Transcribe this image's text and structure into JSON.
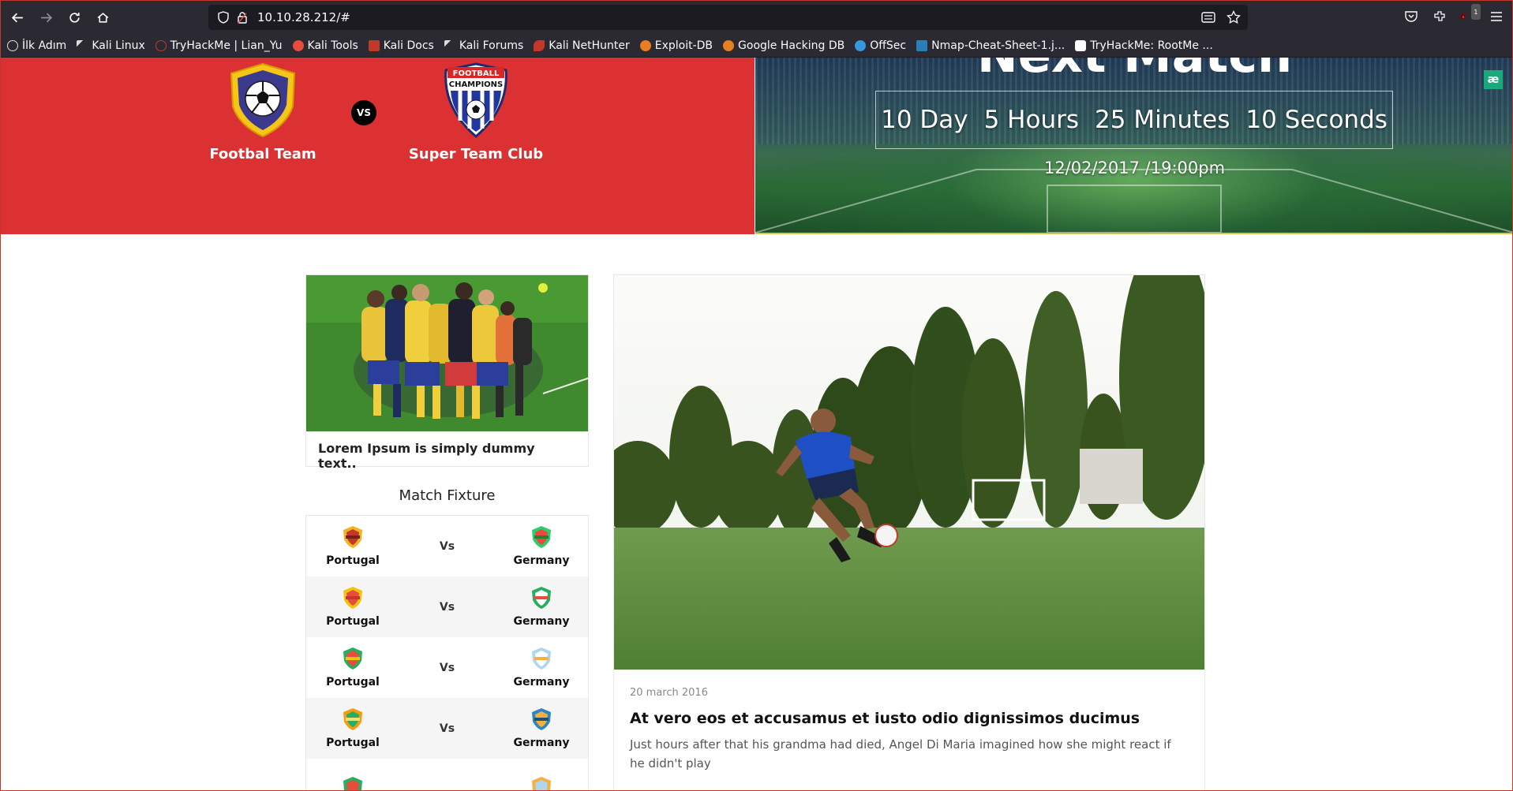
{
  "browser": {
    "url": "10.10.28.212/#",
    "bookmarks": [
      {
        "label": "İlk Adım",
        "color": "#cccccc"
      },
      {
        "label": "Kali Linux",
        "color": "#2b2a33"
      },
      {
        "label": "TryHackMe | Lian_Yu",
        "color": "#c0392b"
      },
      {
        "label": "Kali Tools",
        "color": "#e74c3c"
      },
      {
        "label": "Kali Docs",
        "color": "#c0392b"
      },
      {
        "label": "Kali Forums",
        "color": "#2b2a33"
      },
      {
        "label": "Kali NetHunter",
        "color": "#c0392b"
      },
      {
        "label": "Exploit-DB",
        "color": "#e67e22"
      },
      {
        "label": "Google Hacking DB",
        "color": "#e67e22"
      },
      {
        "label": "OffSec",
        "color": "#3498db"
      },
      {
        "label": "Nmap-Cheat-Sheet-1.j...",
        "color": "#2980b9"
      },
      {
        "label": "TryHackMe: RootMe ...",
        "color": "#ffffff"
      }
    ],
    "notification_count": "1"
  },
  "next_match": {
    "title": "Next Match",
    "home_team": "Footbal Team",
    "away_team": "Super Team Club",
    "vs_label": "VS",
    "away_logo_text": [
      "FOOTBALL",
      "CHAMPIONS"
    ],
    "countdown": {
      "days": "10 Day",
      "hours": "5 Hours",
      "minutes": "25 Minutes",
      "seconds": "10 Seconds"
    },
    "date": "12/02/2017 /19:00pm",
    "badge": "æ"
  },
  "news": {
    "title": "Lorem Ipsum is simply dummy text.."
  },
  "fixture": {
    "title": "Match Fixture",
    "rows": [
      {
        "home": "Portugal",
        "vs": "Vs",
        "away": "Germany"
      },
      {
        "home": "Portugal",
        "vs": "Vs",
        "away": "Germany"
      },
      {
        "home": "Portugal",
        "vs": "Vs",
        "away": "Germany"
      },
      {
        "home": "Portugal",
        "vs": "Vs",
        "away": "Germany"
      }
    ]
  },
  "featured": {
    "date": "20 march 2016",
    "title": "At vero eos et accusamus et iusto odio dignissimos ducimus",
    "text": "Just hours after that his grandma had died, Angel Di Maria imagined how she might react if he didn't play"
  },
  "colors": {
    "accent_red": "#dc3132",
    "browser_chrome": "#2b2a33"
  }
}
